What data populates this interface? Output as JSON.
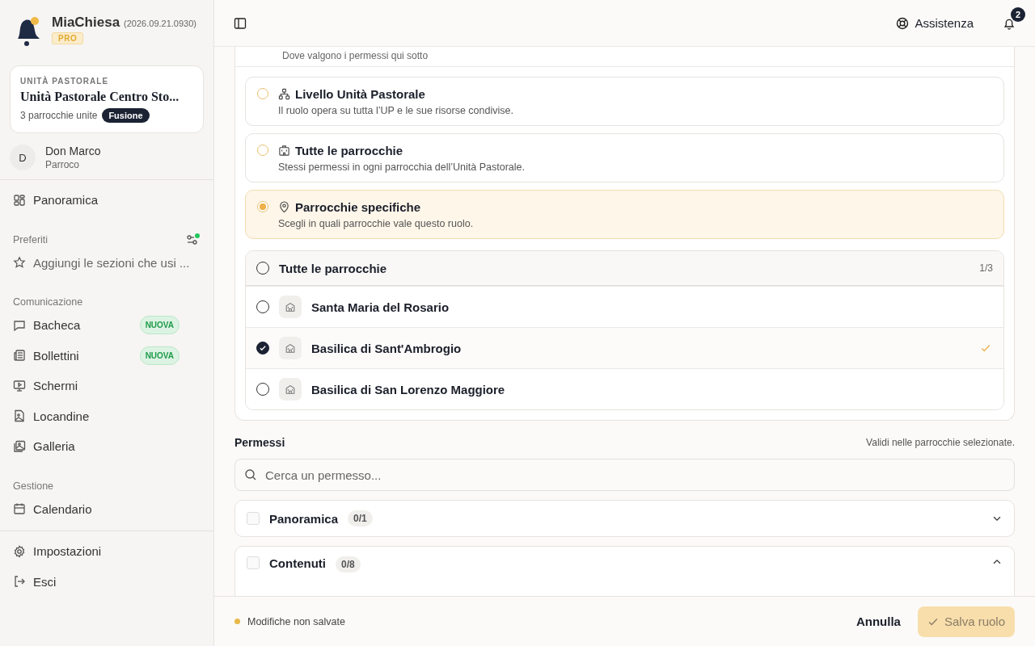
{
  "app": {
    "name": "MiaChiesa",
    "version": "(2026.09.21.0930)",
    "plan": "PRO"
  },
  "unit": {
    "label": "UNITÀ PASTORALE",
    "name": "Unità Pastorale Centro Sto...",
    "parishes": "3 parrocchie unite",
    "badge": "Fusione"
  },
  "user": {
    "initial": "D",
    "name": "Don Marco",
    "role": "Parroco"
  },
  "sidebar": {
    "top": [
      {
        "label": "Panoramica",
        "selected": false
      }
    ],
    "favorites": {
      "title": "Preferiti",
      "placeholder": "Aggiungi le sezioni che usi ..."
    },
    "sections": [
      {
        "title": "Comunicazione",
        "items": [
          {
            "label": "Bacheca",
            "badge": "NUOVA"
          },
          {
            "label": "Bollettini",
            "badge": "NUOVA"
          },
          {
            "label": "Schermi"
          },
          {
            "label": "Locandine"
          },
          {
            "label": "Galleria"
          }
        ]
      },
      {
        "title": "Gestione",
        "items": [
          {
            "label": "Calendario"
          }
        ]
      }
    ],
    "bottom": [
      {
        "label": "Impostazioni"
      },
      {
        "label": "Esci"
      }
    ]
  },
  "header": {
    "help": "Assistenza",
    "notifications": "2"
  },
  "scope": {
    "subtitle": "Dove valgono i permessi qui sotto",
    "options": [
      {
        "title": "Livello Unità Pastorale",
        "description": "Il ruolo opera su tutta l’UP e le sue risorse condivise.",
        "selected": false
      },
      {
        "title": "Tutte le parrocchie",
        "description": "Stessi permessi in ogni parrocchia dell’Unità Pastorale.",
        "selected": false
      },
      {
        "title": "Parrocchie specifiche",
        "description": "Scegli in quali parrocchie vale questo ruolo.",
        "selected": true
      }
    ],
    "all": {
      "label": "Tutte le parrocchie",
      "checked": false,
      "count": "1/3"
    },
    "parishes": [
      {
        "name": "Santa Maria del Rosario",
        "checked": false
      },
      {
        "name": "Basilica di Sant'Ambrogio",
        "checked": true
      },
      {
        "name": "Basilica di San Lorenzo Maggiore",
        "checked": false
      }
    ]
  },
  "permissions": {
    "title": "Permessi",
    "note": "Validi nelle parrocchie selezionate.",
    "search": {
      "placeholder": "Cerca un permesso..."
    },
    "groups": [
      {
        "name": "Panoramica",
        "count": "0/1",
        "checked": false,
        "expanded": false
      },
      {
        "name": "Contenuti",
        "count": "0/8",
        "checked": false,
        "expanded": true
      }
    ]
  },
  "footer": {
    "status": "Modifiche non salvate",
    "cancel": "Annulla",
    "save": "Salva ruolo",
    "save_disabled": true
  }
}
